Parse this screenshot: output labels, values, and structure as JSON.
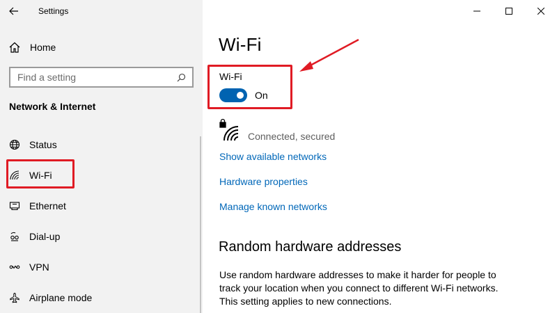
{
  "window": {
    "title": "Settings"
  },
  "sidebar": {
    "home_label": "Home",
    "search_placeholder": "Find a setting",
    "section_title": "Network & Internet",
    "items": [
      {
        "label": "Status",
        "icon": "globe-icon"
      },
      {
        "label": "Wi-Fi",
        "icon": "wifi-icon"
      },
      {
        "label": "Ethernet",
        "icon": "ethernet-icon"
      },
      {
        "label": "Dial-up",
        "icon": "dialup-icon"
      },
      {
        "label": "VPN",
        "icon": "vpn-icon"
      },
      {
        "label": "Airplane mode",
        "icon": "airplane-icon"
      }
    ]
  },
  "main": {
    "title": "Wi-Fi",
    "wifi_label": "Wi-Fi",
    "toggle_state": "On",
    "network_status": "Connected, secured",
    "links": [
      "Show available networks",
      "Hardware properties",
      "Manage known networks"
    ],
    "random_hw_heading": "Random hardware addresses",
    "random_hw_description": "Use random hardware addresses to make it harder for people to track your location when you connect to different Wi-Fi networks. This setting applies to new connections."
  },
  "colors": {
    "accent": "#0063b1",
    "link": "#0067b8",
    "annotation": "#e01b24",
    "sidebar_bg": "#f2f2f2"
  }
}
